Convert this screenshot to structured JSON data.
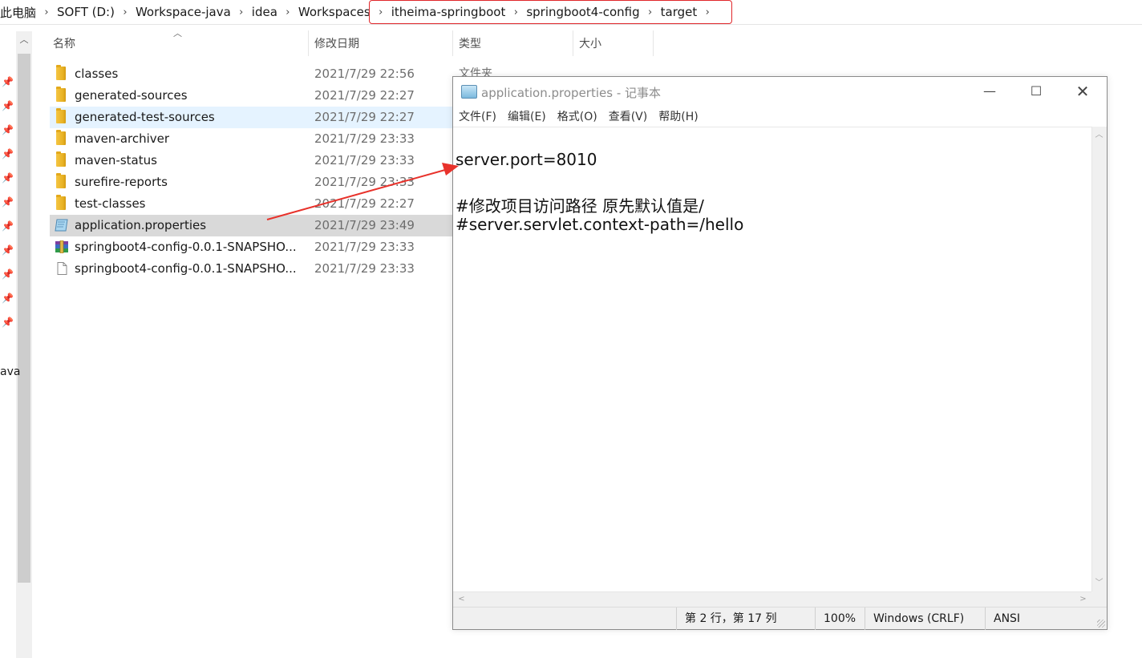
{
  "breadcrumb": {
    "items": [
      "此电脑",
      "SOFT (D:)",
      "Workspace-java",
      "idea",
      "Workspaces",
      "itheima-springboot",
      "springboot4-config",
      "target"
    ],
    "separator": "›"
  },
  "columns": {
    "name": "名称",
    "modified": "修改日期",
    "type": "类型",
    "size": "大小"
  },
  "files": [
    {
      "name": "classes",
      "modified": "2021/7/29 22:56",
      "icon": "folder-icon"
    },
    {
      "name": "generated-sources",
      "modified": "2021/7/29 22:27",
      "icon": "folder-icon"
    },
    {
      "name": "generated-test-sources",
      "modified": "2021/7/29 22:27",
      "icon": "folder-icon"
    },
    {
      "name": "maven-archiver",
      "modified": "2021/7/29 23:33",
      "icon": "folder-icon"
    },
    {
      "name": "maven-status",
      "modified": "2021/7/29 23:33",
      "icon": "folder-icon"
    },
    {
      "name": "surefire-reports",
      "modified": "2021/7/29 23:33",
      "icon": "folder-icon"
    },
    {
      "name": "test-classes",
      "modified": "2021/7/29 22:27",
      "icon": "folder-icon"
    },
    {
      "name": "application.properties",
      "modified": "2021/7/29 23:49",
      "icon": "properties-file-icon"
    },
    {
      "name": "springboot4-config-0.0.1-SNAPSHO...",
      "modified": "2021/7/29 23:33",
      "icon": "archive-icon"
    },
    {
      "name": "springboot4-config-0.0.1-SNAPSHO...",
      "modified": "2021/7/29 23:33",
      "icon": "file-icon"
    }
  ],
  "type_peek": "文件夹",
  "nav_partial_label": "ava",
  "notepad": {
    "title": "application.properties - 记事本",
    "menus": [
      "文件(F)",
      "编辑(E)",
      "格式(O)",
      "查看(V)",
      "帮助(H)"
    ],
    "lines": [
      "server.port=8010",
      "",
      "#修改项目访问路径 原先默认值是/",
      "#server.servlet.context-path=/hello"
    ],
    "status": {
      "position": "第 2 行，第 17 列",
      "zoom": "100%",
      "line_ending": "Windows (CRLF)",
      "encoding": "ANSI"
    }
  },
  "colors": {
    "highlight_border": "#e0262a",
    "arrow": "#e8322b",
    "hover_row": "#e5f3ff",
    "selected_row": "#d9d9d9"
  }
}
